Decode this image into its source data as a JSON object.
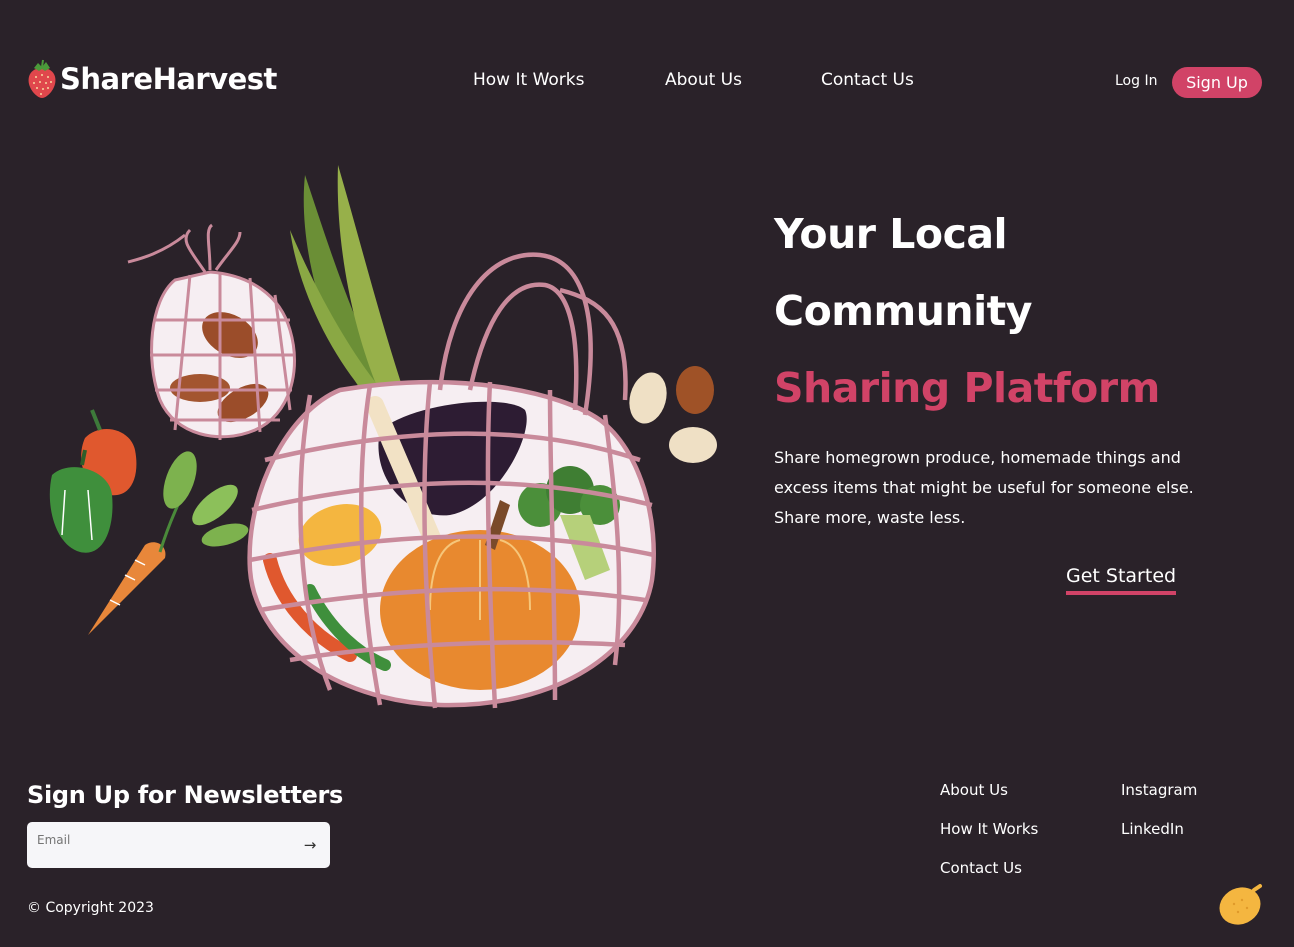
{
  "brand": {
    "name": "ShareHarvest",
    "logo_icon": "strawberry-icon"
  },
  "nav": {
    "items": [
      "How It Works",
      "About Us",
      "Contact Us"
    ]
  },
  "auth": {
    "login_label": "Log In",
    "signup_label": "Sign Up"
  },
  "hero": {
    "title_line1": "Your Local",
    "title_line2": "Community",
    "title_line3": "Sharing Platform",
    "description": "Share homegrown produce, homemade things and excess items that might be useful for someone else. Share more, waste less.",
    "cta_label": "Get Started",
    "illustration": "produce-mesh-bags-illustration"
  },
  "newsletter": {
    "title": "Sign Up for Newsletters",
    "email_placeholder": "Email",
    "submit_icon": "arrow-right-icon"
  },
  "footer": {
    "links_col1": [
      "About Us",
      "How It Works",
      "Contact Us"
    ],
    "links_col2": [
      "Instagram",
      "LinkedIn"
    ],
    "copyright": "© Copyright 2023",
    "corner_icon": "lemon-icon"
  },
  "colors": {
    "background": "#2a2229",
    "accent": "#d14367",
    "text": "#ffffff"
  }
}
